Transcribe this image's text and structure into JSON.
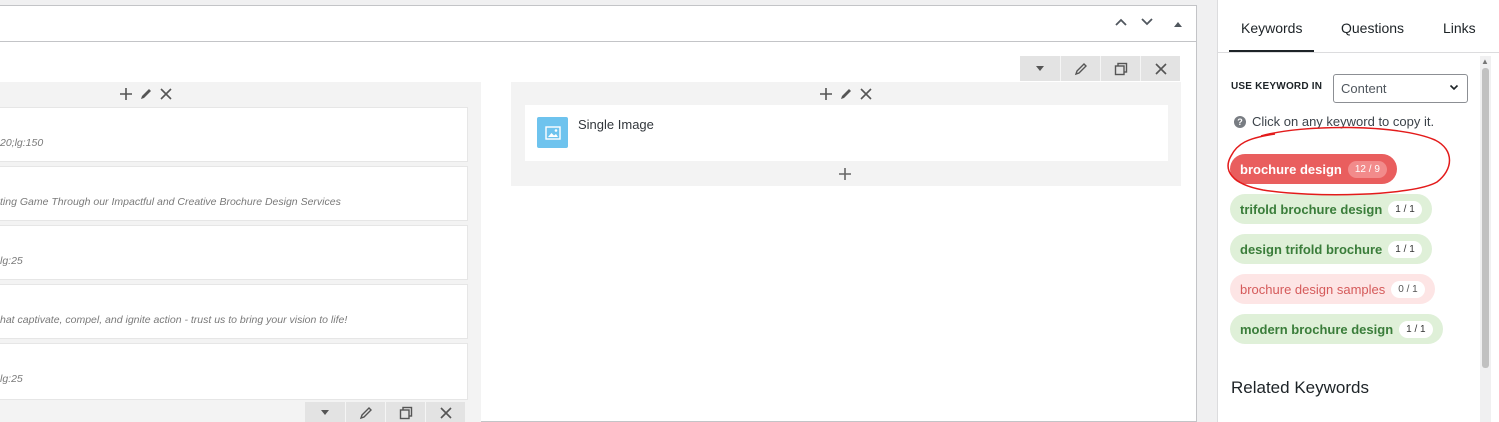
{
  "editor": {
    "header_controls": [
      "up-icon",
      "down-icon",
      "collapse-icon"
    ],
    "left_column": {
      "elements": [
        {
          "text": "20;lg:150"
        },
        {
          "text": "ting Game Through our Impactful and Creative Brochure Design Services"
        },
        {
          "text": "lg:25"
        },
        {
          "text": "hat captivate, compel, and ignite action - trust us to bring your vision to life!"
        },
        {
          "text": "lg:25"
        }
      ]
    },
    "right_column": {
      "single_image_label": "Single Image"
    }
  },
  "sidebar": {
    "tabs": [
      {
        "label": "Keywords",
        "active": true
      },
      {
        "label": "Questions",
        "active": false
      },
      {
        "label": "Links",
        "active": false
      }
    ],
    "use_keyword_in_label": "USE KEYWORD IN",
    "use_keyword_in_value": "Content",
    "hint": "Click on any keyword to copy it.",
    "keywords": [
      {
        "text": "brochure design",
        "count": "12 / 9",
        "status": "red"
      },
      {
        "text": "trifold brochure design",
        "count": "1 / 1",
        "status": "green"
      },
      {
        "text": "design trifold brochure",
        "count": "1 / 1",
        "status": "green"
      },
      {
        "text": "brochure design samples",
        "count": "0 / 1",
        "status": "pink"
      },
      {
        "text": "modern brochure design",
        "count": "1 / 1",
        "status": "green"
      }
    ],
    "related_keywords_heading": "Related Keywords"
  },
  "colors": {
    "overuse": "#e95e5e",
    "good": "#dff0d8",
    "missing": "#fde5e5",
    "annotation": "#e31b1b"
  }
}
